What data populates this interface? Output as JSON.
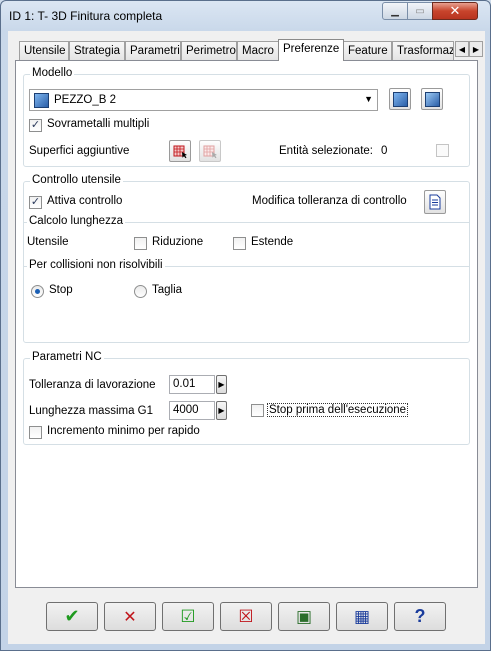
{
  "window": {
    "title": "ID 1: T- 3D Finitura completa",
    "minimize_glyph": "▁",
    "maximize_glyph": "▭",
    "close_glyph": "✕"
  },
  "tabs": [
    {
      "label": "Utensile"
    },
    {
      "label": "Strategia"
    },
    {
      "label": "Parametri"
    },
    {
      "label": "Perimetro"
    },
    {
      "label": "Macro"
    },
    {
      "label": "Preferenze",
      "active": true
    },
    {
      "label": "Feature"
    },
    {
      "label": "Trasformaz"
    }
  ],
  "tab_scroll": {
    "left": "◀",
    "right": "▶"
  },
  "modello": {
    "group_label": "Modello",
    "model_select_value": "PEZZO_B 2",
    "dropdown_glyph": "▼",
    "sovrametalli_label": "Sovrametalli multipli",
    "sovrametalli_checked": "✓",
    "superfici_label": "Superfici aggiuntive",
    "entita_label": "Entità selezionate:",
    "entita_count": "0"
  },
  "controllo": {
    "group_label": "Controllo utensile",
    "attiva_label": "Attiva controllo",
    "attiva_checked": "✓",
    "modifica_label": "Modifica tolleranza di controllo",
    "calcolo_label": "Calcolo lunghezza",
    "utensile_label": "Utensile",
    "riduzione_label": "Riduzione",
    "estende_label": "Estende",
    "collisioni_label": "Per collisioni non risolvibili",
    "stop_label": "Stop",
    "taglia_label": "Taglia"
  },
  "parametri_nc": {
    "group_label": "Parametri NC",
    "tolleranza_label": "Tolleranza di lavorazione",
    "tolleranza_value": "0.01",
    "lunghezza_label": "Lunghezza massima G1",
    "lunghezza_value": "4000",
    "stop_prima_label": "Stop prima dell'esecuzione",
    "incremento_label": "Incremento minimo per rapido",
    "spin_glyph": "▶"
  },
  "bottom_buttons": [
    {
      "icon": "checkmark-icon",
      "glyph": "✔",
      "color": "#1f9a1f"
    },
    {
      "icon": "cross-icon",
      "glyph": "✕",
      "color": "#c0141a"
    },
    {
      "icon": "apply-icon",
      "glyph": "☑",
      "color": "#1f9a1f"
    },
    {
      "icon": "reset-icon",
      "glyph": "☒",
      "color": "#c0141a"
    },
    {
      "icon": "preview-icon",
      "glyph": "▣",
      "color": "#2b6e2b"
    },
    {
      "icon": "save-icon",
      "glyph": "▦",
      "color": "#1a3c9c"
    },
    {
      "icon": "help-icon",
      "glyph": "?",
      "color": "#1a3c9c"
    }
  ]
}
